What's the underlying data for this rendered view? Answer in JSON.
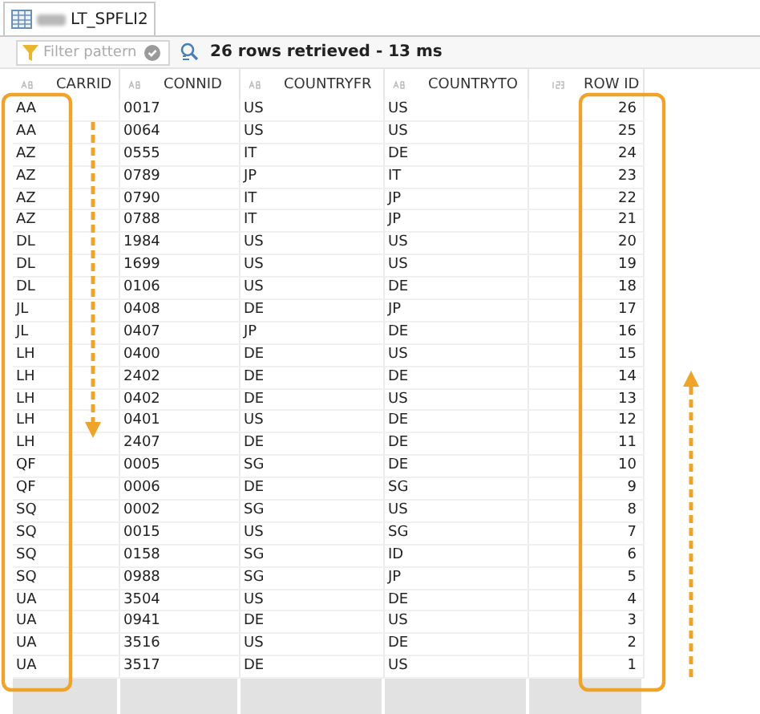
{
  "tab": {
    "label": "LT_SPFLI2",
    "selected": true
  },
  "filter": {
    "placeholder": "Filter pattern"
  },
  "status": "26 rows retrieved - 13 ms",
  "table": {
    "columns": [
      {
        "label": "CARRID",
        "kind": "text"
      },
      {
        "label": "CONNID",
        "kind": "text"
      },
      {
        "label": "COUNTRYFR",
        "kind": "text"
      },
      {
        "label": "COUNTRYTO",
        "kind": "text"
      },
      {
        "label": "ROW ID",
        "kind": "number"
      }
    ],
    "rows": [
      [
        "AA",
        "0017",
        "US",
        "US",
        "26"
      ],
      [
        "AA",
        "0064",
        "US",
        "US",
        "25"
      ],
      [
        "AZ",
        "0555",
        "IT",
        "DE",
        "24"
      ],
      [
        "AZ",
        "0789",
        "JP",
        "IT",
        "23"
      ],
      [
        "AZ",
        "0790",
        "IT",
        "JP",
        "22"
      ],
      [
        "AZ",
        "0788",
        "IT",
        "JP",
        "21"
      ],
      [
        "DL",
        "1984",
        "US",
        "US",
        "20"
      ],
      [
        "DL",
        "1699",
        "US",
        "US",
        "19"
      ],
      [
        "DL",
        "0106",
        "US",
        "DE",
        "18"
      ],
      [
        "JL",
        "0408",
        "DE",
        "JP",
        "17"
      ],
      [
        "JL",
        "0407",
        "JP",
        "DE",
        "16"
      ],
      [
        "LH",
        "0400",
        "DE",
        "US",
        "15"
      ],
      [
        "LH",
        "2402",
        "DE",
        "DE",
        "14"
      ],
      [
        "LH",
        "0402",
        "DE",
        "US",
        "13"
      ],
      [
        "LH",
        "0401",
        "US",
        "DE",
        "12"
      ],
      [
        "LH",
        "2407",
        "DE",
        "DE",
        "11"
      ],
      [
        "QF",
        "0005",
        "SG",
        "DE",
        "10"
      ],
      [
        "QF",
        "0006",
        "DE",
        "SG",
        "9"
      ],
      [
        "SQ",
        "0002",
        "SG",
        "US",
        "8"
      ],
      [
        "SQ",
        "0015",
        "US",
        "SG",
        "7"
      ],
      [
        "SQ",
        "0158",
        "SG",
        "ID",
        "6"
      ],
      [
        "SQ",
        "0988",
        "SG",
        "JP",
        "5"
      ],
      [
        "UA",
        "3504",
        "US",
        "DE",
        "4"
      ],
      [
        "UA",
        "0941",
        "DE",
        "US",
        "3"
      ],
      [
        "UA",
        "3516",
        "US",
        "DE",
        "2"
      ],
      [
        "UA",
        "3517",
        "DE",
        "US",
        "1"
      ]
    ]
  }
}
